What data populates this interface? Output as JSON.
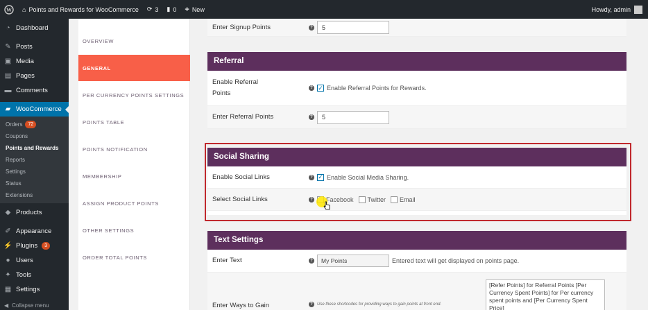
{
  "adminbar": {
    "site_name": "Points and Rewards for WooCommerce",
    "updates_count": "3",
    "comments_count": "0",
    "new_label": "New",
    "howdy": "Howdy, admin"
  },
  "sidebar": {
    "dashboard": "Dashboard",
    "posts": "Posts",
    "media": "Media",
    "pages": "Pages",
    "comments": "Comments",
    "woocommerce": "WooCommerce",
    "submenu": [
      {
        "label": "Orders",
        "badge": "72"
      },
      {
        "label": "Coupons"
      },
      {
        "label": "Points and Rewards"
      },
      {
        "label": "Reports"
      },
      {
        "label": "Settings"
      },
      {
        "label": "Status"
      },
      {
        "label": "Extensions"
      }
    ],
    "products": "Products",
    "appearance": "Appearance",
    "plugins": "Plugins",
    "plugins_badge": "3",
    "users": "Users",
    "tools": "Tools",
    "settings": "Settings",
    "collapse": "Collapse menu"
  },
  "tabs": [
    "OVERVIEW",
    "GENERAL",
    "PER CURRENCY POINTS SETTINGS",
    "POINTS TABLE",
    "POINTS NOTIFICATION",
    "MEMBERSHIP",
    "ASSIGN PRODUCT POINTS",
    "OTHER SETTINGS",
    "ORDER TOTAL POINTS"
  ],
  "active_tab": "GENERAL",
  "signup": {
    "label": "Enter Signup Points",
    "value": "5"
  },
  "referral": {
    "title": "Referral",
    "enable_label_1": "Enable Referral",
    "enable_label_2": "Points",
    "enable_desc": "Enable Referral Points for Rewards.",
    "points_label": "Enter Referral Points",
    "points_value": "5"
  },
  "social": {
    "title": "Social Sharing",
    "enable_label": "Enable Social Links",
    "enable_desc": "Enable Social Media Sharing.",
    "select_label": "Select Social Links",
    "facebook": "Facebook",
    "twitter": "Twitter",
    "email": "Email"
  },
  "text_settings": {
    "title": "Text Settings",
    "enter_text_label": "Enter Text",
    "enter_text_value": "My Points",
    "enter_text_desc": "Entered text will get displayed on points page.",
    "ways_label": "Enter Ways to Gain",
    "ways_help": "Use these shortcodes for providing ways to gain points at front end.",
    "shortcodes_1": "[Refer Points] for Referral Points [Per",
    "shortcodes_2": "Currency Spent Points] for Per currency",
    "shortcodes_3": "spent points and [Per Currency Spent Price]"
  },
  "colors": {
    "section_header": "#5d2f5d",
    "active_tab": "#f85f48",
    "wp_blue": "#0073aa",
    "highlight_border": "#c0282d"
  }
}
